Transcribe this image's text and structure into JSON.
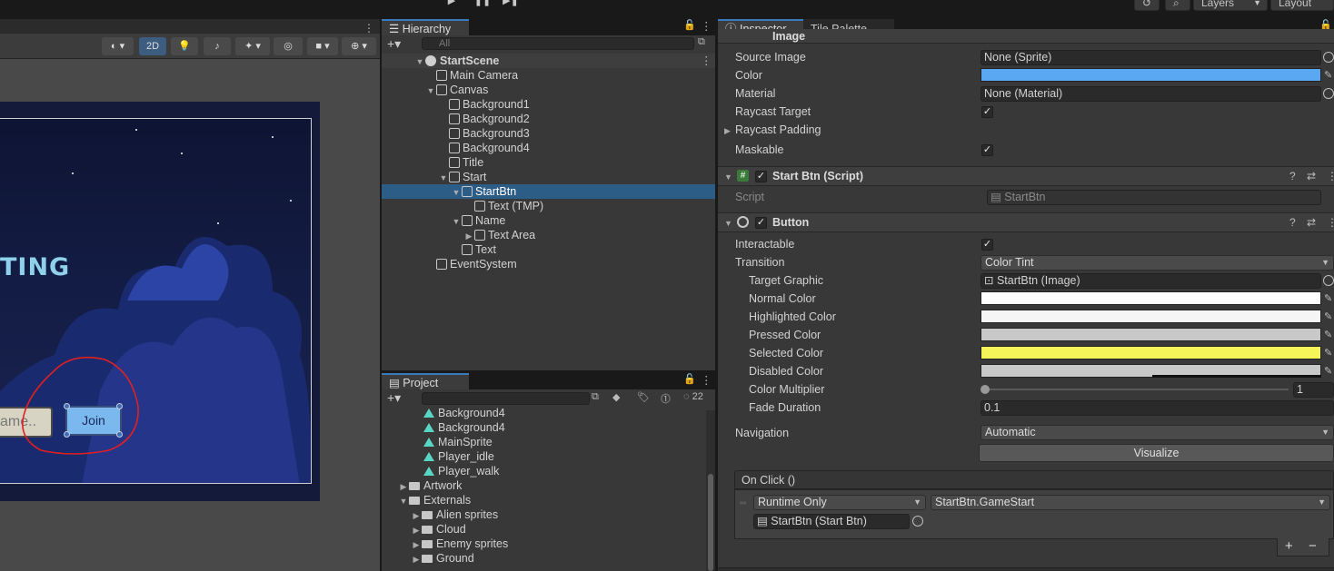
{
  "toolbar": {
    "play_icon": "play-icon",
    "pause_icon": "pause-icon",
    "step_icon": "step-icon",
    "layers_label": "Layers",
    "layout_label": "Layout"
  },
  "scene": {
    "btn_2d": "2D",
    "game": {
      "title_text": "TING",
      "name_placeholder": "ame..",
      "join_label": "Join"
    }
  },
  "hierarchy": {
    "tab_label": "Hierarchy",
    "search_placeholder": "All",
    "scene_name": "StartScene",
    "items": [
      {
        "label": "Main Camera"
      },
      {
        "label": "Canvas"
      },
      {
        "label": "Background1"
      },
      {
        "label": "Background2"
      },
      {
        "label": "Background3"
      },
      {
        "label": "Background4"
      },
      {
        "label": "Title"
      },
      {
        "label": "Start"
      },
      {
        "label": "StartBtn"
      },
      {
        "label": "Text (TMP)"
      },
      {
        "label": "Name"
      },
      {
        "label": "Text Area"
      },
      {
        "label": "Text"
      },
      {
        "label": "EventSystem"
      }
    ]
  },
  "project": {
    "tab_label": "Project",
    "hidden_count": "22",
    "items": [
      {
        "label": "Background4"
      },
      {
        "label": "Background4"
      },
      {
        "label": "MainSprite"
      },
      {
        "label": "Player_idle"
      },
      {
        "label": "Player_walk"
      },
      {
        "label": "Artwork"
      },
      {
        "label": "Externals"
      },
      {
        "label": "Alien sprites"
      },
      {
        "label": "Cloud"
      },
      {
        "label": "Enemy sprites"
      },
      {
        "label": "Ground"
      }
    ]
  },
  "inspector": {
    "tab_label": "Inspector",
    "tab2_label": "Tile Palette",
    "image_header": "Image",
    "image": {
      "source_image_label": "Source Image",
      "source_image_value": "None (Sprite)",
      "color_label": "Color",
      "color_value": "#5aa7f2",
      "material_label": "Material",
      "material_value": "None (Material)",
      "raycast_target_label": "Raycast Target",
      "raycast_padding_label": "Raycast Padding",
      "maskable_label": "Maskable"
    },
    "script_component": {
      "title": "Start Btn (Script)",
      "script_label": "Script",
      "script_value": "StartBtn"
    },
    "button_component": {
      "title": "Button",
      "interactable_label": "Interactable",
      "transition_label": "Transition",
      "transition_value": "Color Tint",
      "target_graphic_label": "Target Graphic",
      "target_graphic_value": "StartBtn (Image)",
      "normal_color_label": "Normal Color",
      "highlighted_color_label": "Highlighted Color",
      "pressed_color_label": "Pressed Color",
      "selected_color_label": "Selected Color",
      "disabled_color_label": "Disabled Color",
      "color_multiplier_label": "Color Multiplier",
      "color_multiplier_value": "1",
      "fade_duration_label": "Fade Duration",
      "fade_duration_value": "0.1",
      "navigation_label": "Navigation",
      "navigation_value": "Automatic",
      "visualize_label": "Visualize",
      "colors": {
        "normal": "#ffffff",
        "highlighted": "#f5f5f5",
        "pressed": "#c8c8c8",
        "selected": "#f5f55a",
        "disabled": "#c8c8c8"
      }
    },
    "on_click": {
      "header": "On Click ()",
      "runtime_value": "Runtime Only",
      "function_value": "StartBtn.GameStart",
      "object_value": "StartBtn (Start Btn)",
      "add_label": "+",
      "remove_label": "−"
    }
  }
}
